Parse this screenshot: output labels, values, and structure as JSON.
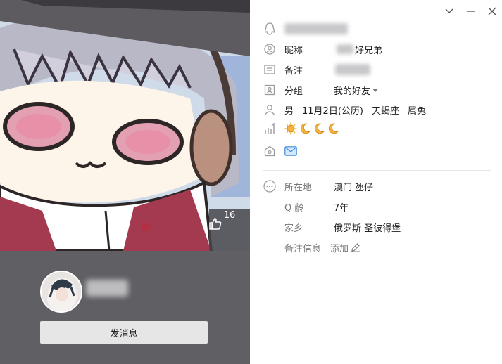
{
  "cover": {
    "likes": "16"
  },
  "profile": {
    "send_message": "发消息"
  },
  "window": {
    "icons": [
      "chevron-down-icon",
      "minimize-icon",
      "close-icon"
    ]
  },
  "info": {
    "nickname_label": "昵称",
    "nickname_value": "好兄弟",
    "remark_label": "备注",
    "group_label": "分组",
    "group_value": "我的好友",
    "gender": "男",
    "birthday": "11月2日(公历)",
    "zodiac": "天蝎座",
    "chinese_zodiac": "属兔",
    "level_icons": [
      "sun-icon",
      "moon-icon",
      "moon-icon",
      "moon-icon"
    ]
  },
  "details": {
    "location_label": "所在地",
    "location_city": "澳门",
    "location_district": "氹仔",
    "qage_label": "Q 龄",
    "qage_value": "7年",
    "hometown_label": "家乡",
    "hometown_value": "俄罗斯 圣彼得堡",
    "note_label": "备注信息",
    "note_add": "添加"
  },
  "colors": {
    "left_bg": "#5f5f64",
    "cover_bg": "#cfdbe9",
    "button_bg": "#e6e6e6",
    "icon_gray": "#9a9aa0",
    "sun": "#f2b43a",
    "moon": "#f2b43a"
  }
}
